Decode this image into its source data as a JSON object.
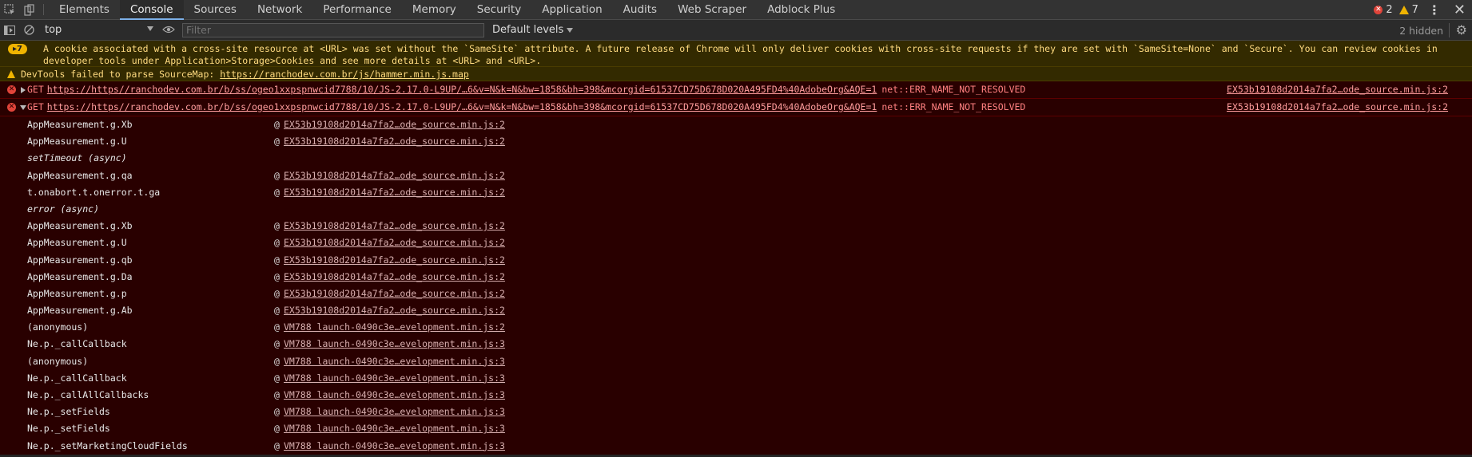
{
  "tabs": [
    "Elements",
    "Console",
    "Sources",
    "Network",
    "Performance",
    "Memory",
    "Security",
    "Application",
    "Audits",
    "Web Scraper",
    "Adblock Plus"
  ],
  "active_tab": "Console",
  "counts": {
    "errors": "2",
    "warnings": "7"
  },
  "toolbar": {
    "context": "top",
    "filter_placeholder": "Filter",
    "levels": "Default levels",
    "hidden": "2 hidden"
  },
  "warnings": {
    "cookie": {
      "badge": "7",
      "text": "A cookie associated with a cross-site resource at <URL> was set without the `SameSite` attribute. A future release of Chrome will only deliver cookies with cross-site requests if they are set with `SameSite=None` and `Secure`. You can review cookies in developer tools under Application>Storage>Cookies and see more details at <URL> and <URL>."
    },
    "sourcemap": {
      "text": "DevTools failed to parse SourceMap: ",
      "link": "https://ranchodev.com.br/js/hammer.min.js.map"
    }
  },
  "errors": [
    {
      "method": "GET",
      "url": "https://https//ranchodev.com.br/b/ss/ogeo1xxpspnwcid7788/10/JS-2.17.0-L9UP/…6&v=N&k=N&bw=1858&bh=398&mcorgid=61537CD75D678D020A495FD4%40AdobeOrg&AQE=1",
      "status": "net::ERR_NAME_NOT_RESOLVED",
      "source": "EX53b19108d2014a7fa2…ode_source.min.js:2"
    },
    {
      "method": "GET",
      "url": "https://https//ranchodev.com.br/b/ss/ogeo1xxpspnwcid7788/10/JS-2.17.0-L9UP/…6&v=N&k=N&bw=1858&bh=398&mcorgid=61537CD75D678D020A495FD4%40AdobeOrg&AQE=1",
      "status": "net::ERR_NAME_NOT_RESOLVED",
      "source": "EX53b19108d2014a7fa2…ode_source.min.js:2"
    }
  ],
  "stack": [
    {
      "fn": "AppMeasurement.g.Xb",
      "loc": "EX53b19108d2014a7fa2…ode_source.min.js:2"
    },
    {
      "fn": "AppMeasurement.g.U",
      "loc": "EX53b19108d2014a7fa2…ode_source.min.js:2"
    },
    {
      "fn": "setTimeout (async)",
      "async": true
    },
    {
      "fn": "AppMeasurement.g.qa",
      "loc": "EX53b19108d2014a7fa2…ode_source.min.js:2"
    },
    {
      "fn": "t.onabort.t.onerror.t.ga",
      "loc": "EX53b19108d2014a7fa2…ode_source.min.js:2"
    },
    {
      "fn": "error (async)",
      "async": true
    },
    {
      "fn": "AppMeasurement.g.Xb",
      "loc": "EX53b19108d2014a7fa2…ode_source.min.js:2"
    },
    {
      "fn": "AppMeasurement.g.U",
      "loc": "EX53b19108d2014a7fa2…ode_source.min.js:2"
    },
    {
      "fn": "AppMeasurement.g.qb",
      "loc": "EX53b19108d2014a7fa2…ode_source.min.js:2"
    },
    {
      "fn": "AppMeasurement.g.Da",
      "loc": "EX53b19108d2014a7fa2…ode_source.min.js:2"
    },
    {
      "fn": "AppMeasurement.g.p",
      "loc": "EX53b19108d2014a7fa2…ode_source.min.js:2"
    },
    {
      "fn": "AppMeasurement.g.Ab",
      "loc": "EX53b19108d2014a7fa2…ode_source.min.js:2"
    },
    {
      "fn": "(anonymous)",
      "loc": "VM788 launch-0490c3e…evelopment.min.js:2"
    },
    {
      "fn": "Ne.p._callCallback",
      "loc": "VM788 launch-0490c3e…evelopment.min.js:3"
    },
    {
      "fn": "(anonymous)",
      "loc": "VM788 launch-0490c3e…evelopment.min.js:3"
    },
    {
      "fn": "Ne.p._callCallback",
      "loc": "VM788 launch-0490c3e…evelopment.min.js:3"
    },
    {
      "fn": "Ne.p._callAllCallbacks",
      "loc": "VM788 launch-0490c3e…evelopment.min.js:3"
    },
    {
      "fn": "Ne.p._setFields",
      "loc": "VM788 launch-0490c3e…evelopment.min.js:3"
    },
    {
      "fn": "Ne.p._setFields",
      "loc": "VM788 launch-0490c3e…evelopment.min.js:3"
    },
    {
      "fn": "Ne.p._setMarketingCloudFields",
      "loc": "VM788 launch-0490c3e…evelopment.min.js:3"
    }
  ],
  "icons": {
    "inspect": "inspect-element-icon",
    "device": "device-toolbar-icon",
    "sidebar": "sidebar-toggle-icon",
    "clear": "clear-console-icon",
    "eye": "live-expression-icon",
    "gear": "settings-gear-icon"
  }
}
